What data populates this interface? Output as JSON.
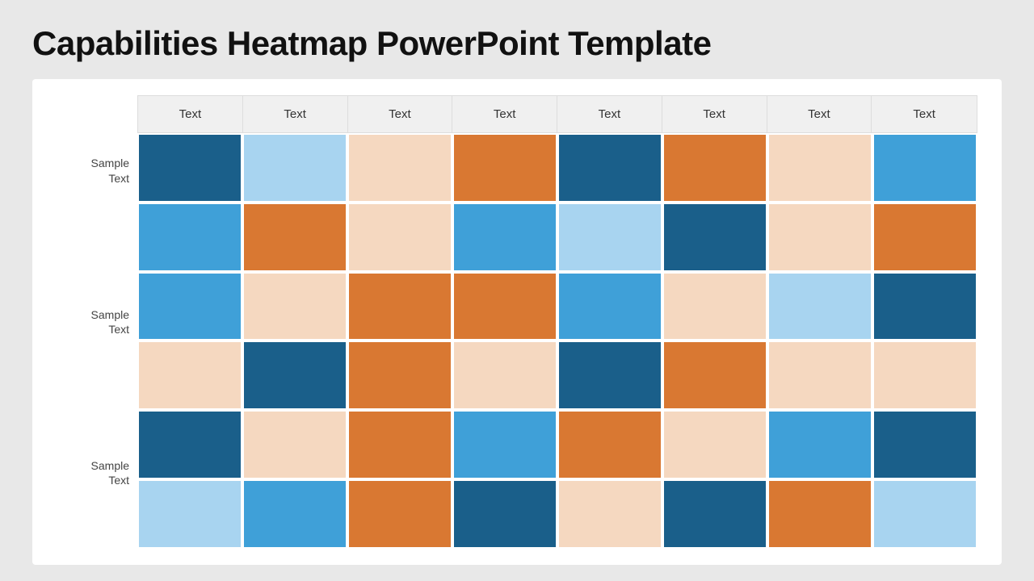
{
  "title": "Capabilities Heatmap PowerPoint Template",
  "header": {
    "cells": [
      "Text",
      "Text",
      "Text",
      "Text",
      "Text",
      "Text",
      "Text",
      "Text"
    ]
  },
  "row_groups": [
    {
      "label": "Sample\nText",
      "rows": [
        [
          "dark-blue",
          "light-blue",
          "peach",
          "orange",
          "dark-blue",
          "orange",
          "peach",
          "sky-blue"
        ],
        [
          "sky-blue",
          "orange",
          "peach",
          "sky-blue",
          "light-blue",
          "dark-blue",
          "peach",
          "orange"
        ]
      ]
    },
    {
      "label": "Sample\nText",
      "rows": [
        [
          "sky-blue",
          "peach",
          "orange",
          "orange",
          "sky-blue",
          "peach",
          "light-blue",
          "dark-blue"
        ],
        [
          "peach",
          "dark-blue",
          "orange",
          "peach",
          "dark-blue",
          "orange",
          "peach",
          "peach"
        ]
      ]
    },
    {
      "label": "Sample\nText",
      "rows": [
        [
          "dark-blue",
          "peach",
          "orange",
          "sky-blue",
          "orange",
          "peach",
          "sky-blue",
          "dark-blue"
        ],
        [
          "light-blue",
          "sky-blue",
          "orange",
          "dark-blue",
          "peach",
          "dark-blue",
          "orange",
          "light-blue"
        ]
      ]
    }
  ],
  "colors": {
    "dark-blue": "#1a5f8a",
    "sky-blue": "#3fa0d8",
    "light-blue": "#a8d4f0",
    "orange": "#d97832",
    "peach": "#f5d8c0",
    "white": "#ffffff"
  }
}
